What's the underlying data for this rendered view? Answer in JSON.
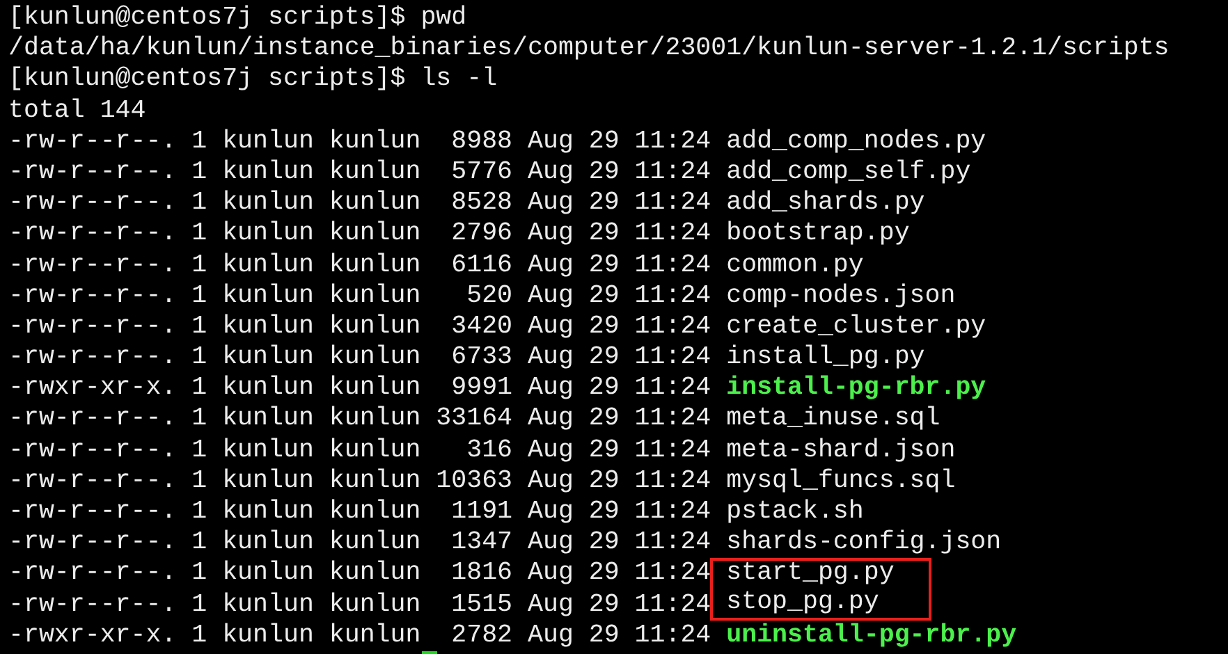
{
  "terminal": {
    "lines": [
      {
        "text": "[kunlun@centos7j scripts]$ pwd"
      },
      {
        "text": "/data/ha/kunlun/instance_binaries/computer/23001/kunlun-server-1.2.1/scripts"
      },
      {
        "text": "[kunlun@centos7j scripts]$ ls -l"
      },
      {
        "text": "total 144"
      }
    ],
    "listing": [
      {
        "permissions": "-rw-r--r--.",
        "links": "1",
        "owner": "kunlun",
        "group": "kunlun",
        "size": "8988",
        "month": "Aug",
        "day": "29",
        "time": "11:24",
        "name": "add_comp_nodes.py",
        "executable": false,
        "highlighted": false
      },
      {
        "permissions": "-rw-r--r--.",
        "links": "1",
        "owner": "kunlun",
        "group": "kunlun",
        "size": "5776",
        "month": "Aug",
        "day": "29",
        "time": "11:24",
        "name": "add_comp_self.py",
        "executable": false,
        "highlighted": false
      },
      {
        "permissions": "-rw-r--r--.",
        "links": "1",
        "owner": "kunlun",
        "group": "kunlun",
        "size": "8528",
        "month": "Aug",
        "day": "29",
        "time": "11:24",
        "name": "add_shards.py",
        "executable": false,
        "highlighted": false
      },
      {
        "permissions": "-rw-r--r--.",
        "links": "1",
        "owner": "kunlun",
        "group": "kunlun",
        "size": "2796",
        "month": "Aug",
        "day": "29",
        "time": "11:24",
        "name": "bootstrap.py",
        "executable": false,
        "highlighted": false
      },
      {
        "permissions": "-rw-r--r--.",
        "links": "1",
        "owner": "kunlun",
        "group": "kunlun",
        "size": "6116",
        "month": "Aug",
        "day": "29",
        "time": "11:24",
        "name": "common.py",
        "executable": false,
        "highlighted": false
      },
      {
        "permissions": "-rw-r--r--.",
        "links": "1",
        "owner": "kunlun",
        "group": "kunlun",
        "size": "520",
        "month": "Aug",
        "day": "29",
        "time": "11:24",
        "name": "comp-nodes.json",
        "executable": false,
        "highlighted": false
      },
      {
        "permissions": "-rw-r--r--.",
        "links": "1",
        "owner": "kunlun",
        "group": "kunlun",
        "size": "3420",
        "month": "Aug",
        "day": "29",
        "time": "11:24",
        "name": "create_cluster.py",
        "executable": false,
        "highlighted": false
      },
      {
        "permissions": "-rw-r--r--.",
        "links": "1",
        "owner": "kunlun",
        "group": "kunlun",
        "size": "6733",
        "month": "Aug",
        "day": "29",
        "time": "11:24",
        "name": "install_pg.py",
        "executable": false,
        "highlighted": false
      },
      {
        "permissions": "-rwxr-xr-x.",
        "links": "1",
        "owner": "kunlun",
        "group": "kunlun",
        "size": "9991",
        "month": "Aug",
        "day": "29",
        "time": "11:24",
        "name": "install-pg-rbr.py",
        "executable": true,
        "highlighted": false
      },
      {
        "permissions": "-rw-r--r--.",
        "links": "1",
        "owner": "kunlun",
        "group": "kunlun",
        "size": "33164",
        "month": "Aug",
        "day": "29",
        "time": "11:24",
        "name": "meta_inuse.sql",
        "executable": false,
        "highlighted": false
      },
      {
        "permissions": "-rw-r--r--.",
        "links": "1",
        "owner": "kunlun",
        "group": "kunlun",
        "size": "316",
        "month": "Aug",
        "day": "29",
        "time": "11:24",
        "name": "meta-shard.json",
        "executable": false,
        "highlighted": false
      },
      {
        "permissions": "-rw-r--r--.",
        "links": "1",
        "owner": "kunlun",
        "group": "kunlun",
        "size": "10363",
        "month": "Aug",
        "day": "29",
        "time": "11:24",
        "name": "mysql_funcs.sql",
        "executable": false,
        "highlighted": false
      },
      {
        "permissions": "-rw-r--r--.",
        "links": "1",
        "owner": "kunlun",
        "group": "kunlun",
        "size": "1191",
        "month": "Aug",
        "day": "29",
        "time": "11:24",
        "name": "pstack.sh",
        "executable": false,
        "highlighted": false
      },
      {
        "permissions": "-rw-r--r--.",
        "links": "1",
        "owner": "kunlun",
        "group": "kunlun",
        "size": "1347",
        "month": "Aug",
        "day": "29",
        "time": "11:24",
        "name": "shards-config.json",
        "executable": false,
        "highlighted": false
      },
      {
        "permissions": "-rw-r--r--.",
        "links": "1",
        "owner": "kunlun",
        "group": "kunlun",
        "size": "1816",
        "month": "Aug",
        "day": "29",
        "time": "11:24",
        "name": "start_pg.py",
        "executable": false,
        "highlighted": true
      },
      {
        "permissions": "-rw-r--r--.",
        "links": "1",
        "owner": "kunlun",
        "group": "kunlun",
        "size": "1515",
        "month": "Aug",
        "day": "29",
        "time": "11:24",
        "name": "stop_pg.py",
        "executable": false,
        "highlighted": true
      },
      {
        "permissions": "-rwxr-xr-x.",
        "links": "1",
        "owner": "kunlun",
        "group": "kunlun",
        "size": "2782",
        "month": "Aug",
        "day": "29",
        "time": "11:24",
        "name": "uninstall-pg-rbr.py",
        "executable": true,
        "highlighted": false
      }
    ]
  }
}
